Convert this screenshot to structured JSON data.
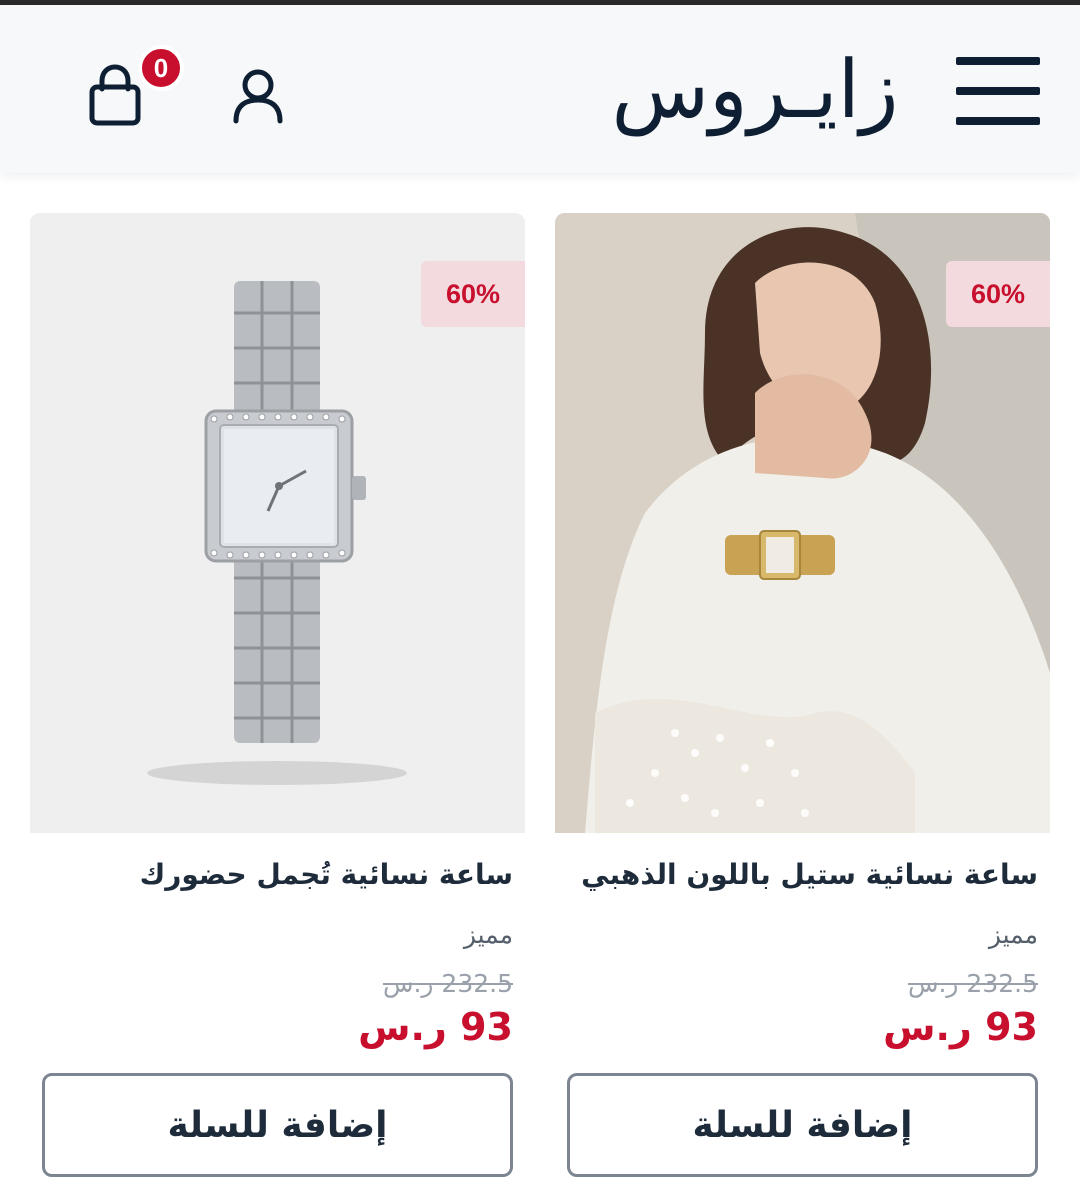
{
  "header": {
    "logo_text": "زايـروس",
    "cart_count": "0",
    "menu_icon": "hamburger-menu-icon",
    "user_icon": "user-icon",
    "cart_icon": "shopping-bag-icon"
  },
  "products": [
    {
      "title": "ساعة نسائية ستيل باللون الذهبي",
      "tag": "مميز",
      "old_price": "232.5 ر.س",
      "price": "93 ر.س",
      "discount": "60%",
      "add_label": "إضافة للسلة",
      "image": "model-wearing-gold-watch"
    },
    {
      "title": "ساعة نسائية تُجمل حضورك",
      "tag": "مميز",
      "old_price": "232.5 ر.س",
      "price": "93 ر.س",
      "discount": "60%",
      "add_label": "إضافة للسلة",
      "image": "silver-square-watch"
    }
  ],
  "colors": {
    "brand_navy": "#0f1f33",
    "sale_red": "#c8102e",
    "badge_bg": "#f3dade"
  }
}
